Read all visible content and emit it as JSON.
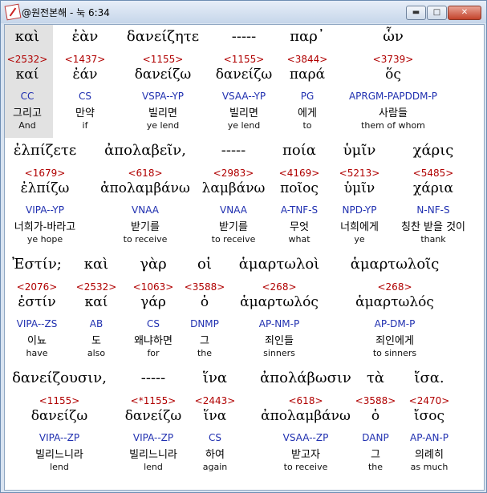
{
  "window": {
    "title": "@원전본해 - 눅 6:34",
    "minimize_label": "▬",
    "maximize_label": "□",
    "close_label": "✕"
  },
  "rows": [
    {
      "words": [
        {
          "greek": "καὶ",
          "strong": "<2532>",
          "lemma": "καί",
          "parse": "CC",
          "korean": "그리고",
          "english": "And"
        },
        {
          "greek": "ἐὰν",
          "strong": "<1437>",
          "lemma": "ἐάν",
          "parse": "CS",
          "korean": "만약",
          "english": "if"
        },
        {
          "greek": "δανείζητε",
          "strong": "<1155>",
          "lemma": "δανείζω",
          "parse": "VSPA--YP",
          "korean": "빌리면",
          "english": "ye lend"
        },
        {
          "greek": "-----",
          "strong": "<1155>",
          "lemma": "δανείζω",
          "parse": "VSAA--YP",
          "korean": "빌리면",
          "english": "ye lend"
        },
        {
          "greek": "παρ᾽",
          "strong": "<3844>",
          "lemma": "παρά",
          "parse": "PG",
          "korean": "에게",
          "english": "to"
        },
        {
          "greek": "ὧν",
          "strong": "<3739>",
          "lemma": "ὅς",
          "parse": "APRGM-PAPDDM-P",
          "korean": "사람들",
          "english": "them of whom"
        }
      ]
    },
    {
      "words": [
        {
          "greek": "ἐλπίζετε",
          "strong": "<1679>",
          "lemma": "ἐλπίζω",
          "parse": "VIPA--YP",
          "korean": "너희가-바라고",
          "english": "ye hope"
        },
        {
          "greek": "ἀπολαβεῖν,",
          "strong": "<618>",
          "lemma": "ἀπολαμβάνω",
          "parse": "VNAA",
          "korean": "받기를",
          "english": "to receive"
        },
        {
          "greek": "-----",
          "strong": "<2983>",
          "lemma": "λαμβάνω",
          "parse": "VNAA",
          "korean": "받기를",
          "english": "to receive"
        },
        {
          "greek": "ποία",
          "strong": "<4169>",
          "lemma": "ποῖος",
          "parse": "A-TNF-S",
          "korean": "무엇",
          "english": "what"
        },
        {
          "greek": "ὑμῖν",
          "strong": "<5213>",
          "lemma": "ὑμῖν",
          "parse": "NPD-YP",
          "korean": "너희에게",
          "english": "ye"
        },
        {
          "greek": "χάρις",
          "strong": "<5485>",
          "lemma": "χάρια",
          "parse": "N-NF-S",
          "korean": "칭찬 받을 것이",
          "english": "thank"
        }
      ]
    },
    {
      "words": [
        {
          "greek": "Ἐστίν;",
          "strong": "<2076>",
          "lemma": "ἐστίν",
          "parse": "VIPA--ZS",
          "korean": "이뇨",
          "english": "have"
        },
        {
          "greek": "καὶ",
          "strong": "<2532>",
          "lemma": "καί",
          "parse": "AB",
          "korean": "도",
          "english": "also"
        },
        {
          "greek": "γὰρ",
          "strong": "<1063>",
          "lemma": "γάρ",
          "parse": "CS",
          "korean": "왜냐하면",
          "english": "for"
        },
        {
          "greek": "οἱ",
          "strong": "<3588>",
          "lemma": "ὁ",
          "parse": "DNMP",
          "korean": "그",
          "english": "the"
        },
        {
          "greek": "ἁμαρτωλοὶ",
          "strong": "<268>",
          "lemma": "ἁμαρτωλός",
          "parse": "AP-NM-P",
          "korean": "죄인들",
          "english": "sinners"
        },
        {
          "greek": "ἁμαρτωλοῖς",
          "strong": "<268>",
          "lemma": "ἁμαρτωλός",
          "parse": "AP-DM-P",
          "korean": "죄인에게",
          "english": "to sinners"
        }
      ]
    },
    {
      "words": [
        {
          "greek": "δανείζουσιν,",
          "strong": "<1155>",
          "lemma": "δανείζω",
          "parse": "VIPA--ZP",
          "korean": "빌리느니라",
          "english": "lend"
        },
        {
          "greek": "-----",
          "strong": "<*1155>",
          "lemma": "δανείζω",
          "parse": "VIPA--ZP",
          "korean": "빌리느니라",
          "english": "lend"
        },
        {
          "greek": "ἵνα",
          "strong": "<2443>",
          "lemma": "ἵνα",
          "parse": "CS",
          "korean": "하여",
          "english": "again"
        },
        {
          "greek": "ἀπολάβωσιν",
          "strong": "<618>",
          "lemma": "ἀπολαμβάνω",
          "parse": "VSAA--ZP",
          "korean": "받고자",
          "english": "to receive"
        },
        {
          "greek": "τὰ",
          "strong": "<3588>",
          "lemma": "ὁ",
          "parse": "DANP",
          "korean": "그",
          "english": "the"
        },
        {
          "greek": "ἴσα.",
          "strong": "<2470>",
          "lemma": "ἴσος",
          "parse": "AP-AN-P",
          "korean": "의례히",
          "english": "as much"
        }
      ]
    }
  ]
}
